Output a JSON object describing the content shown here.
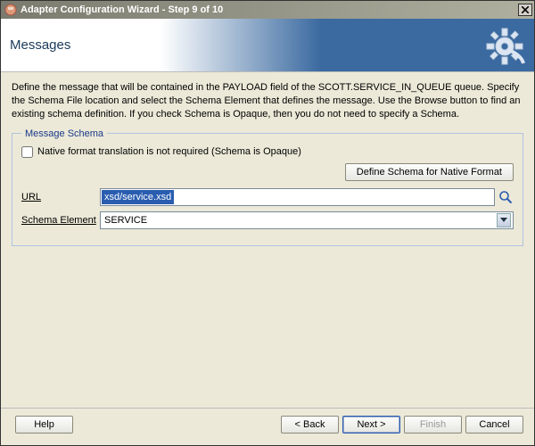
{
  "window": {
    "title": "Adapter Configuration Wizard - Step 9 of 10"
  },
  "header": {
    "heading": "Messages"
  },
  "description": "Define the message that will be contained in the PAYLOAD field of the SCOTT.SERVICE_IN_QUEUE queue.  Specify the Schema File location and select the Schema Element that defines the message. Use the Browse button to find an existing schema definition. If you check Schema is Opaque, then you do not need to specify a Schema.",
  "schema_group": {
    "legend": "Message Schema",
    "opaque_checkbox_label": "Native format translation is not required (Schema is Opaque)",
    "opaque_checked": false,
    "define_native_btn": "Define Schema for Native Format",
    "url_label": "URL",
    "url_value": "xsd/service.xsd",
    "schema_element_label": "Schema Element",
    "schema_element_value": "SERVICE"
  },
  "footer": {
    "help": "Help",
    "back": "< Back",
    "next": "Next >",
    "finish": "Finish",
    "cancel": "Cancel"
  },
  "icons": {
    "app": "app-icon",
    "close": "close-icon",
    "gear": "gear-icon",
    "browse": "magnifier-icon",
    "dropdown": "chevron-down-icon"
  }
}
